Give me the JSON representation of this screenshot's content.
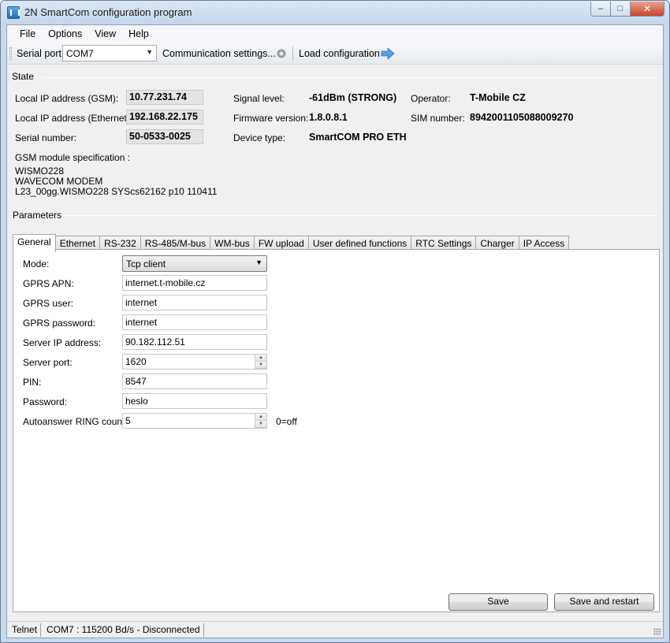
{
  "window": {
    "title": "2N SmartCom configuration program",
    "min": "–",
    "max": "□",
    "close": "✕"
  },
  "menu": [
    "File",
    "Options",
    "View",
    "Help"
  ],
  "toolbar": {
    "serial_port_label": "Serial port",
    "serial_port_value": "COM7",
    "comm_settings": "Communication settings...",
    "load_config": "Load configuration"
  },
  "state": {
    "section": "State",
    "local_ip_gsm_label": "Local IP address (GSM):",
    "local_ip_gsm": "10.77.231.74",
    "local_ip_eth_label": "Local IP address (Ethernet):",
    "local_ip_eth": "192.168.22.175",
    "serial_label": "Serial number:",
    "serial": "50-0533-0025",
    "signal_label": "Signal level:",
    "signal": "-61dBm (STRONG)",
    "firmware_label": "Firmware version:",
    "firmware": "1.8.0.8.1",
    "device_label": "Device type:",
    "device": "SmartCOM PRO ETH",
    "operator_label": "Operator:",
    "operator": "T-Mobile CZ",
    "sim_label": "SIM number:",
    "sim": "8942001105088009270",
    "gsm_spec_label": "GSM module specification :",
    "gsm_spec_lines": [
      "WISMO228",
      "WAVECOM MODEM",
      "L23_00gg.WISMO228 SYScs62162 p10 110411"
    ]
  },
  "parameters": {
    "section": "Parameters",
    "tabs": [
      "General",
      "Ethernet",
      "RS-232",
      "RS-485/M-bus",
      "WM-bus",
      "FW upload",
      "User defined functions",
      "RTC Settings",
      "Charger",
      "IP Access"
    ],
    "general": {
      "mode_label": "Mode:",
      "mode": "Tcp client",
      "apn_label": "GPRS APN:",
      "apn": "internet.t-mobile.cz",
      "user_label": "GPRS user:",
      "user": "internet",
      "gpass_label": "GPRS password:",
      "gpass": "internet",
      "server_ip_label": "Server IP address:",
      "server_ip": "90.182.112.51",
      "server_port_label": "Server port:",
      "server_port": "1620",
      "pin_label": "PIN:",
      "pin": "8547",
      "password_label": "Password:",
      "password": "heslo",
      "ring_label": "Autoanswer RING count",
      "ring": "5",
      "ring_hint": "0=off"
    },
    "save": "Save",
    "save_restart": "Save and restart"
  },
  "status": {
    "mode": "Telnet",
    "connection": "COM7 : 115200 Bd/s - Disconnected"
  }
}
